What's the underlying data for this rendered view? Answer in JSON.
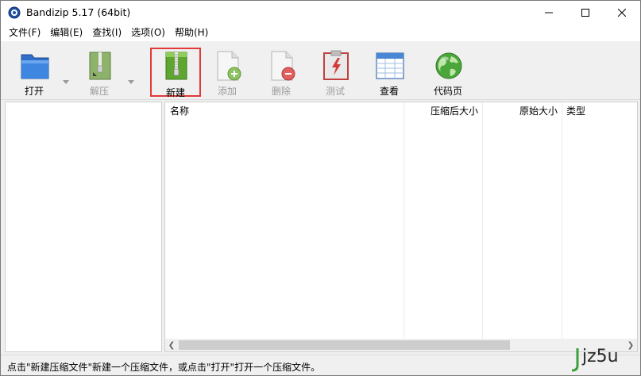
{
  "window": {
    "title": "Bandizip 5.17 (64bit)"
  },
  "menu": [
    "文件(F)",
    "编辑(E)",
    "查找(I)",
    "选项(O)",
    "帮助(H)"
  ],
  "toolbar": {
    "open": "打开",
    "extract": "解压",
    "new": "新建",
    "add": "添加",
    "delete": "删除",
    "test": "测试",
    "view": "查看",
    "codepage": "代码页"
  },
  "columns": {
    "name": "名称",
    "compressed": "压缩后大小",
    "original": "原始大小",
    "type": "类型"
  },
  "status": "点击\"新建压缩文件\"新建一个压缩文件，或点击\"打开\"打开一个压缩文件。",
  "watermark": "jz5u",
  "colors": {
    "accent_selected": "#e03a3a",
    "folder_blue": "#2f6fc9",
    "zip_green": "#5fa631"
  }
}
